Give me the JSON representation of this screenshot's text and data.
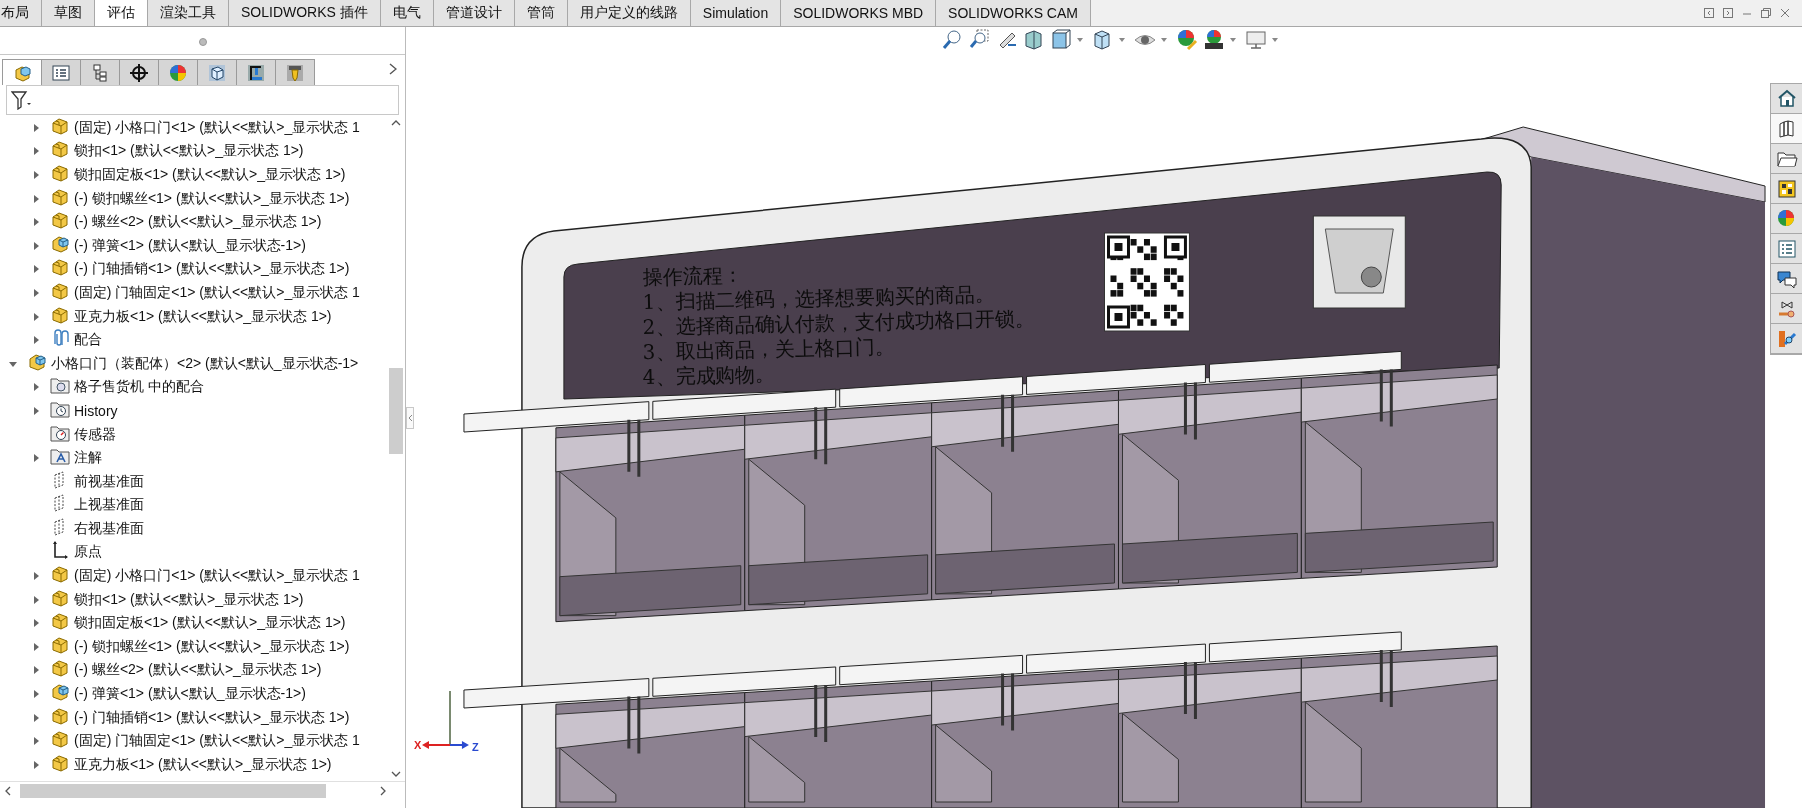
{
  "ribbon_tabs": [
    {
      "label": "布局",
      "selected": false
    },
    {
      "label": "草图",
      "selected": false
    },
    {
      "label": "评估",
      "selected": true
    },
    {
      "label": "渲染工具",
      "selected": false
    },
    {
      "label": "SOLIDWORKS 插件",
      "selected": false
    },
    {
      "label": "电气",
      "selected": false
    },
    {
      "label": "管道设计",
      "selected": false
    },
    {
      "label": "管筒",
      "selected": false
    },
    {
      "label": "用户定义的线路",
      "selected": false
    },
    {
      "label": "Simulation",
      "selected": false
    },
    {
      "label": "SOLIDWORKS MBD",
      "selected": false
    },
    {
      "label": "SOLIDWORKS CAM",
      "selected": false
    }
  ],
  "panel_tabs": [
    {
      "kind": "tree",
      "selected": true
    },
    {
      "kind": "property",
      "selected": false
    },
    {
      "kind": "config",
      "selected": false
    },
    {
      "kind": "target",
      "selected": false
    },
    {
      "kind": "appearance",
      "selected": false
    },
    {
      "kind": "cam-feature",
      "selected": false
    },
    {
      "kind": "cam-ops",
      "selected": false
    },
    {
      "kind": "cam-tool",
      "selected": false
    }
  ],
  "tree": [
    {
      "children": [
        {
          "kind": "part",
          "label": "(固定) 小格口门<1> (默认<<默认>_显示状态 1",
          "expandable": true,
          "expanded": false
        },
        {
          "kind": "part",
          "label": "锁扣<1> (默认<<默认>_显示状态 1>)",
          "expandable": true,
          "expanded": false
        },
        {
          "kind": "part",
          "label": "锁扣固定板<1> (默认<<默认>_显示状态 1>)",
          "expandable": true,
          "expanded": false
        },
        {
          "kind": "part",
          "label": "(-) 锁扣螺丝<1> (默认<<默认>_显示状态 1>)",
          "expandable": true,
          "expanded": false
        },
        {
          "kind": "part",
          "label": "(-) 螺丝<2> (默认<<默认>_显示状态 1>)",
          "expandable": true,
          "expanded": false
        },
        {
          "kind": "assembly",
          "label": "(-) 弹簧<1> (默认<默认_显示状态-1>)",
          "expandable": true,
          "expanded": false
        },
        {
          "kind": "part",
          "label": "(-) 门轴插销<1> (默认<<默认>_显示状态 1>)",
          "expandable": true,
          "expanded": false
        },
        {
          "kind": "part",
          "label": "(固定) 门轴固定<1> (默认<<默认>_显示状态 1",
          "expandable": true,
          "expanded": false
        },
        {
          "kind": "part",
          "label": "亚克力板<1> (默认<<默认>_显示状态 1>)",
          "expandable": true,
          "expanded": false
        },
        {
          "kind": "mates",
          "label": "配合",
          "expandable": true,
          "expanded": false
        }
      ]
    },
    {
      "kind": "assembly",
      "label": "小格口门（装配体）<2> (默认<默认_显示状态-1>",
      "expandable": true,
      "expanded": true,
      "children": [
        {
          "kind": "mates-folder",
          "label": "格子售货机 中的配合",
          "expandable": true,
          "expanded": false
        },
        {
          "kind": "history",
          "label": "History",
          "expandable": true,
          "expanded": false
        },
        {
          "kind": "sensor",
          "label": "传感器",
          "expandable": false
        },
        {
          "kind": "annotation",
          "label": "注解",
          "expandable": true,
          "expanded": false
        },
        {
          "kind": "plane",
          "label": "前视基准面",
          "expandable": false
        },
        {
          "kind": "plane",
          "label": "上视基准面",
          "expandable": false
        },
        {
          "kind": "plane",
          "label": "右视基准面",
          "expandable": false
        },
        {
          "kind": "origin",
          "label": "原点",
          "expandable": false
        },
        {
          "kind": "part",
          "label": "(固定) 小格口门<1> (默认<<默认>_显示状态 1",
          "expandable": true,
          "expanded": false
        },
        {
          "kind": "part",
          "label": "锁扣<1> (默认<<默认>_显示状态 1>)",
          "expandable": true,
          "expanded": false
        },
        {
          "kind": "part",
          "label": "锁扣固定板<1> (默认<<默认>_显示状态 1>)",
          "expandable": true,
          "expanded": false
        },
        {
          "kind": "part",
          "label": "(-) 锁扣螺丝<1> (默认<<默认>_显示状态 1>)",
          "expandable": true,
          "expanded": false
        },
        {
          "kind": "part",
          "label": "(-) 螺丝<2> (默认<<默认>_显示状态 1>)",
          "expandable": true,
          "expanded": false
        },
        {
          "kind": "assembly",
          "label": "(-) 弹簧<1> (默认<默认_显示状态-1>)",
          "expandable": true,
          "expanded": false
        },
        {
          "kind": "part",
          "label": "(-) 门轴插销<1> (默认<<默认>_显示状态 1>)",
          "expandable": true,
          "expanded": false
        },
        {
          "kind": "part",
          "label": "(固定) 门轴固定<1> (默认<<默认>_显示状态 1",
          "expandable": true,
          "expanded": false
        },
        {
          "kind": "part",
          "label": "亚克力板<1> (默认<<默认>_显示状态 1>)",
          "expandable": true,
          "expanded": false
        }
      ]
    }
  ],
  "task_pane": [
    {
      "kind": "home",
      "selected": false
    },
    {
      "kind": "library",
      "selected": true
    },
    {
      "kind": "folder",
      "selected": false
    },
    {
      "kind": "palette",
      "selected": false
    },
    {
      "kind": "appearance",
      "selected": false
    },
    {
      "kind": "properties",
      "selected": false
    },
    {
      "kind": "forum",
      "selected": false
    },
    {
      "kind": "routing",
      "selected": false
    },
    {
      "kind": "custom",
      "selected": false
    }
  ],
  "viewport": {
    "sign_lines": [
      "操作流程：",
      "1、扫描二维码，选择想要购买的商品。",
      "2、选择商品确认付款，支付成功格口开锁。",
      "3、取出商品，关上格口门。",
      "4、完成购物。"
    ],
    "triad": {
      "x_label": "X",
      "z_label": "Z"
    }
  }
}
